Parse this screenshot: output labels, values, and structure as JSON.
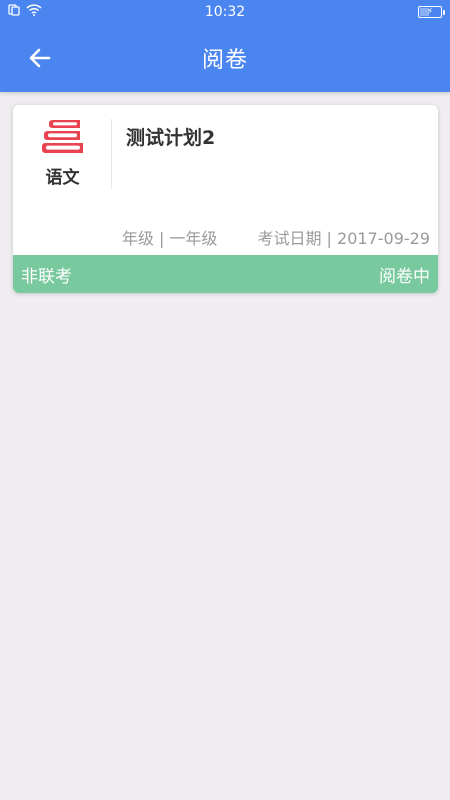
{
  "status_bar": {
    "time": "10:32"
  },
  "header": {
    "title": "阅卷"
  },
  "exam_card": {
    "subject": "语文",
    "title": "测试计划2",
    "grade_label": "年级",
    "grade_value": "一年级",
    "date_label": "考试日期",
    "date_value": "2017-09-29",
    "separator": " | ",
    "exam_type": "非联考",
    "status": "阅卷中"
  },
  "colors": {
    "primary": "#4b86f0",
    "footer_green": "#79c99e",
    "book_red": "#e8434f",
    "background": "#efedf0"
  },
  "icons": [
    "sim-icon",
    "wifi-icon",
    "battery-icon",
    "back-arrow-icon",
    "books-icon"
  ]
}
